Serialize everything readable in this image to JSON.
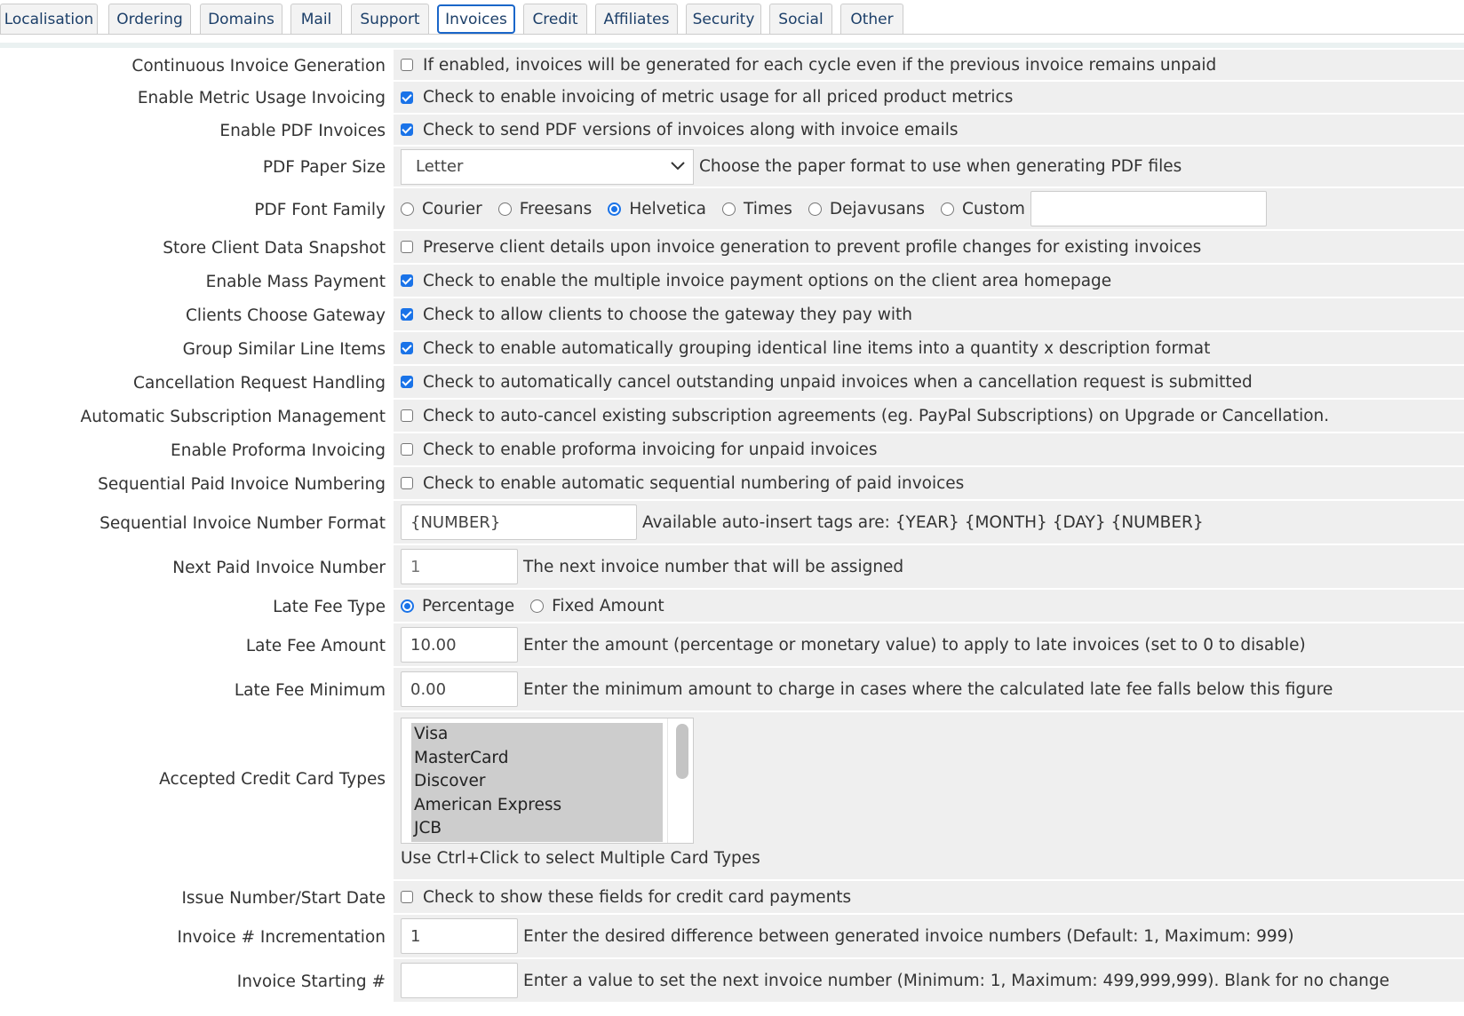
{
  "tabs": [
    "Localisation",
    "Ordering",
    "Domains",
    "Mail",
    "Support",
    "Invoices",
    "Credit",
    "Affiliates",
    "Security",
    "Social",
    "Other"
  ],
  "active_tab": "Invoices",
  "rows": {
    "continuous": {
      "label": "Continuous Invoice Generation",
      "checked": false,
      "desc": "If enabled, invoices will be generated for each cycle even if the previous invoice remains unpaid"
    },
    "metric": {
      "label": "Enable Metric Usage Invoicing",
      "checked": true,
      "desc": "Check to enable invoicing of metric usage for all priced product metrics"
    },
    "pdf": {
      "label": "Enable PDF Invoices",
      "checked": true,
      "desc": "Check to send PDF versions of invoices along with invoice emails"
    },
    "paper": {
      "label": "PDF Paper Size",
      "value": "Letter",
      "desc": "Choose the paper format to use when generating PDF files"
    },
    "font": {
      "label": "PDF Font Family",
      "options": [
        "Courier",
        "Freesans",
        "Helvetica",
        "Times",
        "Dejavusans",
        "Custom"
      ],
      "selected": "Helvetica",
      "custom_value": ""
    },
    "snapshot": {
      "label": "Store Client Data Snapshot",
      "checked": false,
      "desc": "Preserve client details upon invoice generation to prevent profile changes for existing invoices"
    },
    "mass": {
      "label": "Enable Mass Payment",
      "checked": true,
      "desc": "Check to enable the multiple invoice payment options on the client area homepage"
    },
    "gateway": {
      "label": "Clients Choose Gateway",
      "checked": true,
      "desc": "Check to allow clients to choose the gateway they pay with"
    },
    "group": {
      "label": "Group Similar Line Items",
      "checked": true,
      "desc": "Check to enable automatically grouping identical line items into a quantity x description format"
    },
    "cancel": {
      "label": "Cancellation Request Handling",
      "checked": true,
      "desc": "Check to automatically cancel outstanding unpaid invoices when a cancellation request is submitted"
    },
    "subscription": {
      "label": "Automatic Subscription Management",
      "checked": false,
      "desc": "Check to auto-cancel existing subscription agreements (eg. PayPal Subscriptions) on Upgrade or Cancellation."
    },
    "proforma": {
      "label": "Enable Proforma Invoicing",
      "checked": false,
      "desc": "Check to enable proforma invoicing for unpaid invoices"
    },
    "sequential": {
      "label": "Sequential Paid Invoice Numbering",
      "checked": false,
      "desc": "Check to enable automatic sequential numbering of paid invoices"
    },
    "seqformat": {
      "label": "Sequential Invoice Number Format",
      "value": "{NUMBER}",
      "desc": "Available auto-insert tags are: {YEAR} {MONTH} {DAY} {NUMBER}"
    },
    "nextpaid": {
      "label": "Next Paid Invoice Number",
      "placeholder": "1",
      "desc": "The next invoice number that will be assigned"
    },
    "latetype": {
      "label": "Late Fee Type",
      "options": [
        "Percentage",
        "Fixed Amount"
      ],
      "selected": "Percentage"
    },
    "lateamount": {
      "label": "Late Fee Amount",
      "value": "10.00",
      "desc": "Enter the amount (percentage or monetary value) to apply to late invoices (set to 0 to disable)"
    },
    "latemin": {
      "label": "Late Fee Minimum",
      "value": "0.00",
      "desc": "Enter the minimum amount to charge in cases where the calculated late fee falls below this figure"
    },
    "cards": {
      "label": "Accepted Credit Card Types",
      "options": [
        "Visa",
        "MasterCard",
        "Discover",
        "American Express",
        "JCB"
      ],
      "hint": "Use Ctrl+Click to select Multiple Card Types"
    },
    "issue": {
      "label": "Issue Number/Start Date",
      "checked": false,
      "desc": "Check to show these fields for credit card payments"
    },
    "increment": {
      "label": "Invoice # Incrementation",
      "value": "1",
      "desc": "Enter the desired difference between generated invoice numbers (Default: 1, Maximum: 999)"
    },
    "starting": {
      "label": "Invoice Starting #",
      "value": "",
      "desc": "Enter a value to set the next invoice number (Minimum: 1, Maximum: 499,999,999). Blank for no change"
    }
  },
  "colors": {
    "accent": "#1a73e8",
    "tab_text": "#1c3f69",
    "field_bg": "#efefef",
    "selected_option_bg": "#cdcdcd"
  },
  "icons": {
    "select_arrow": "chevron-down-icon"
  }
}
